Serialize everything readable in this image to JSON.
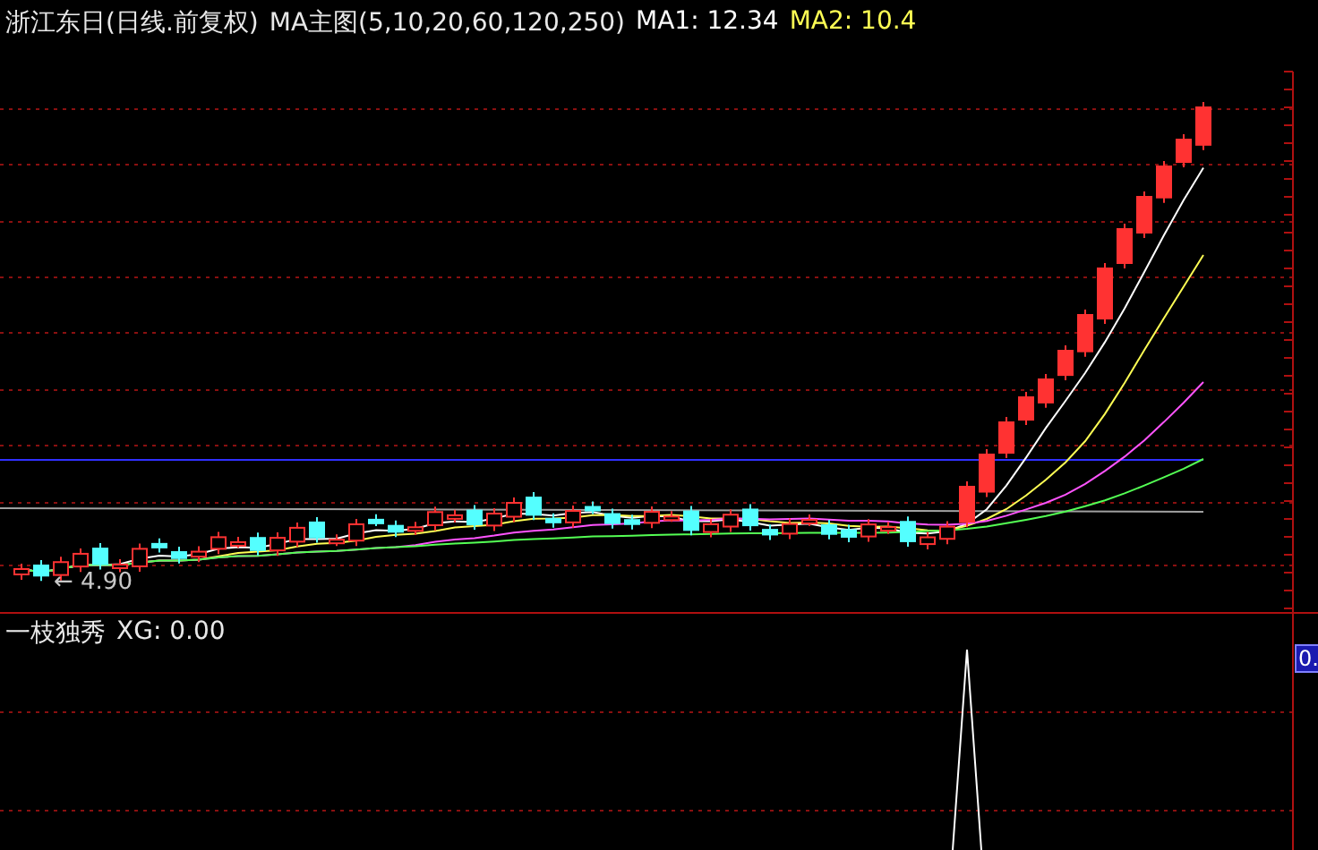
{
  "main_panel": {
    "stock_title": "浙江东日(日线.前复权)",
    "indicator": "MA主图(5,10,20,60,120,250)",
    "averages": [
      {
        "label": "MA1: 12.34",
        "color": "#ffffff"
      },
      {
        "label": "MA2: 10.4",
        "color": "#ffff54"
      }
    ],
    "low_marker": "← 4.90"
  },
  "sub_panel": {
    "indicator": "一枝独秀",
    "value": "XG: 0.00",
    "axis_label": "0."
  }
}
